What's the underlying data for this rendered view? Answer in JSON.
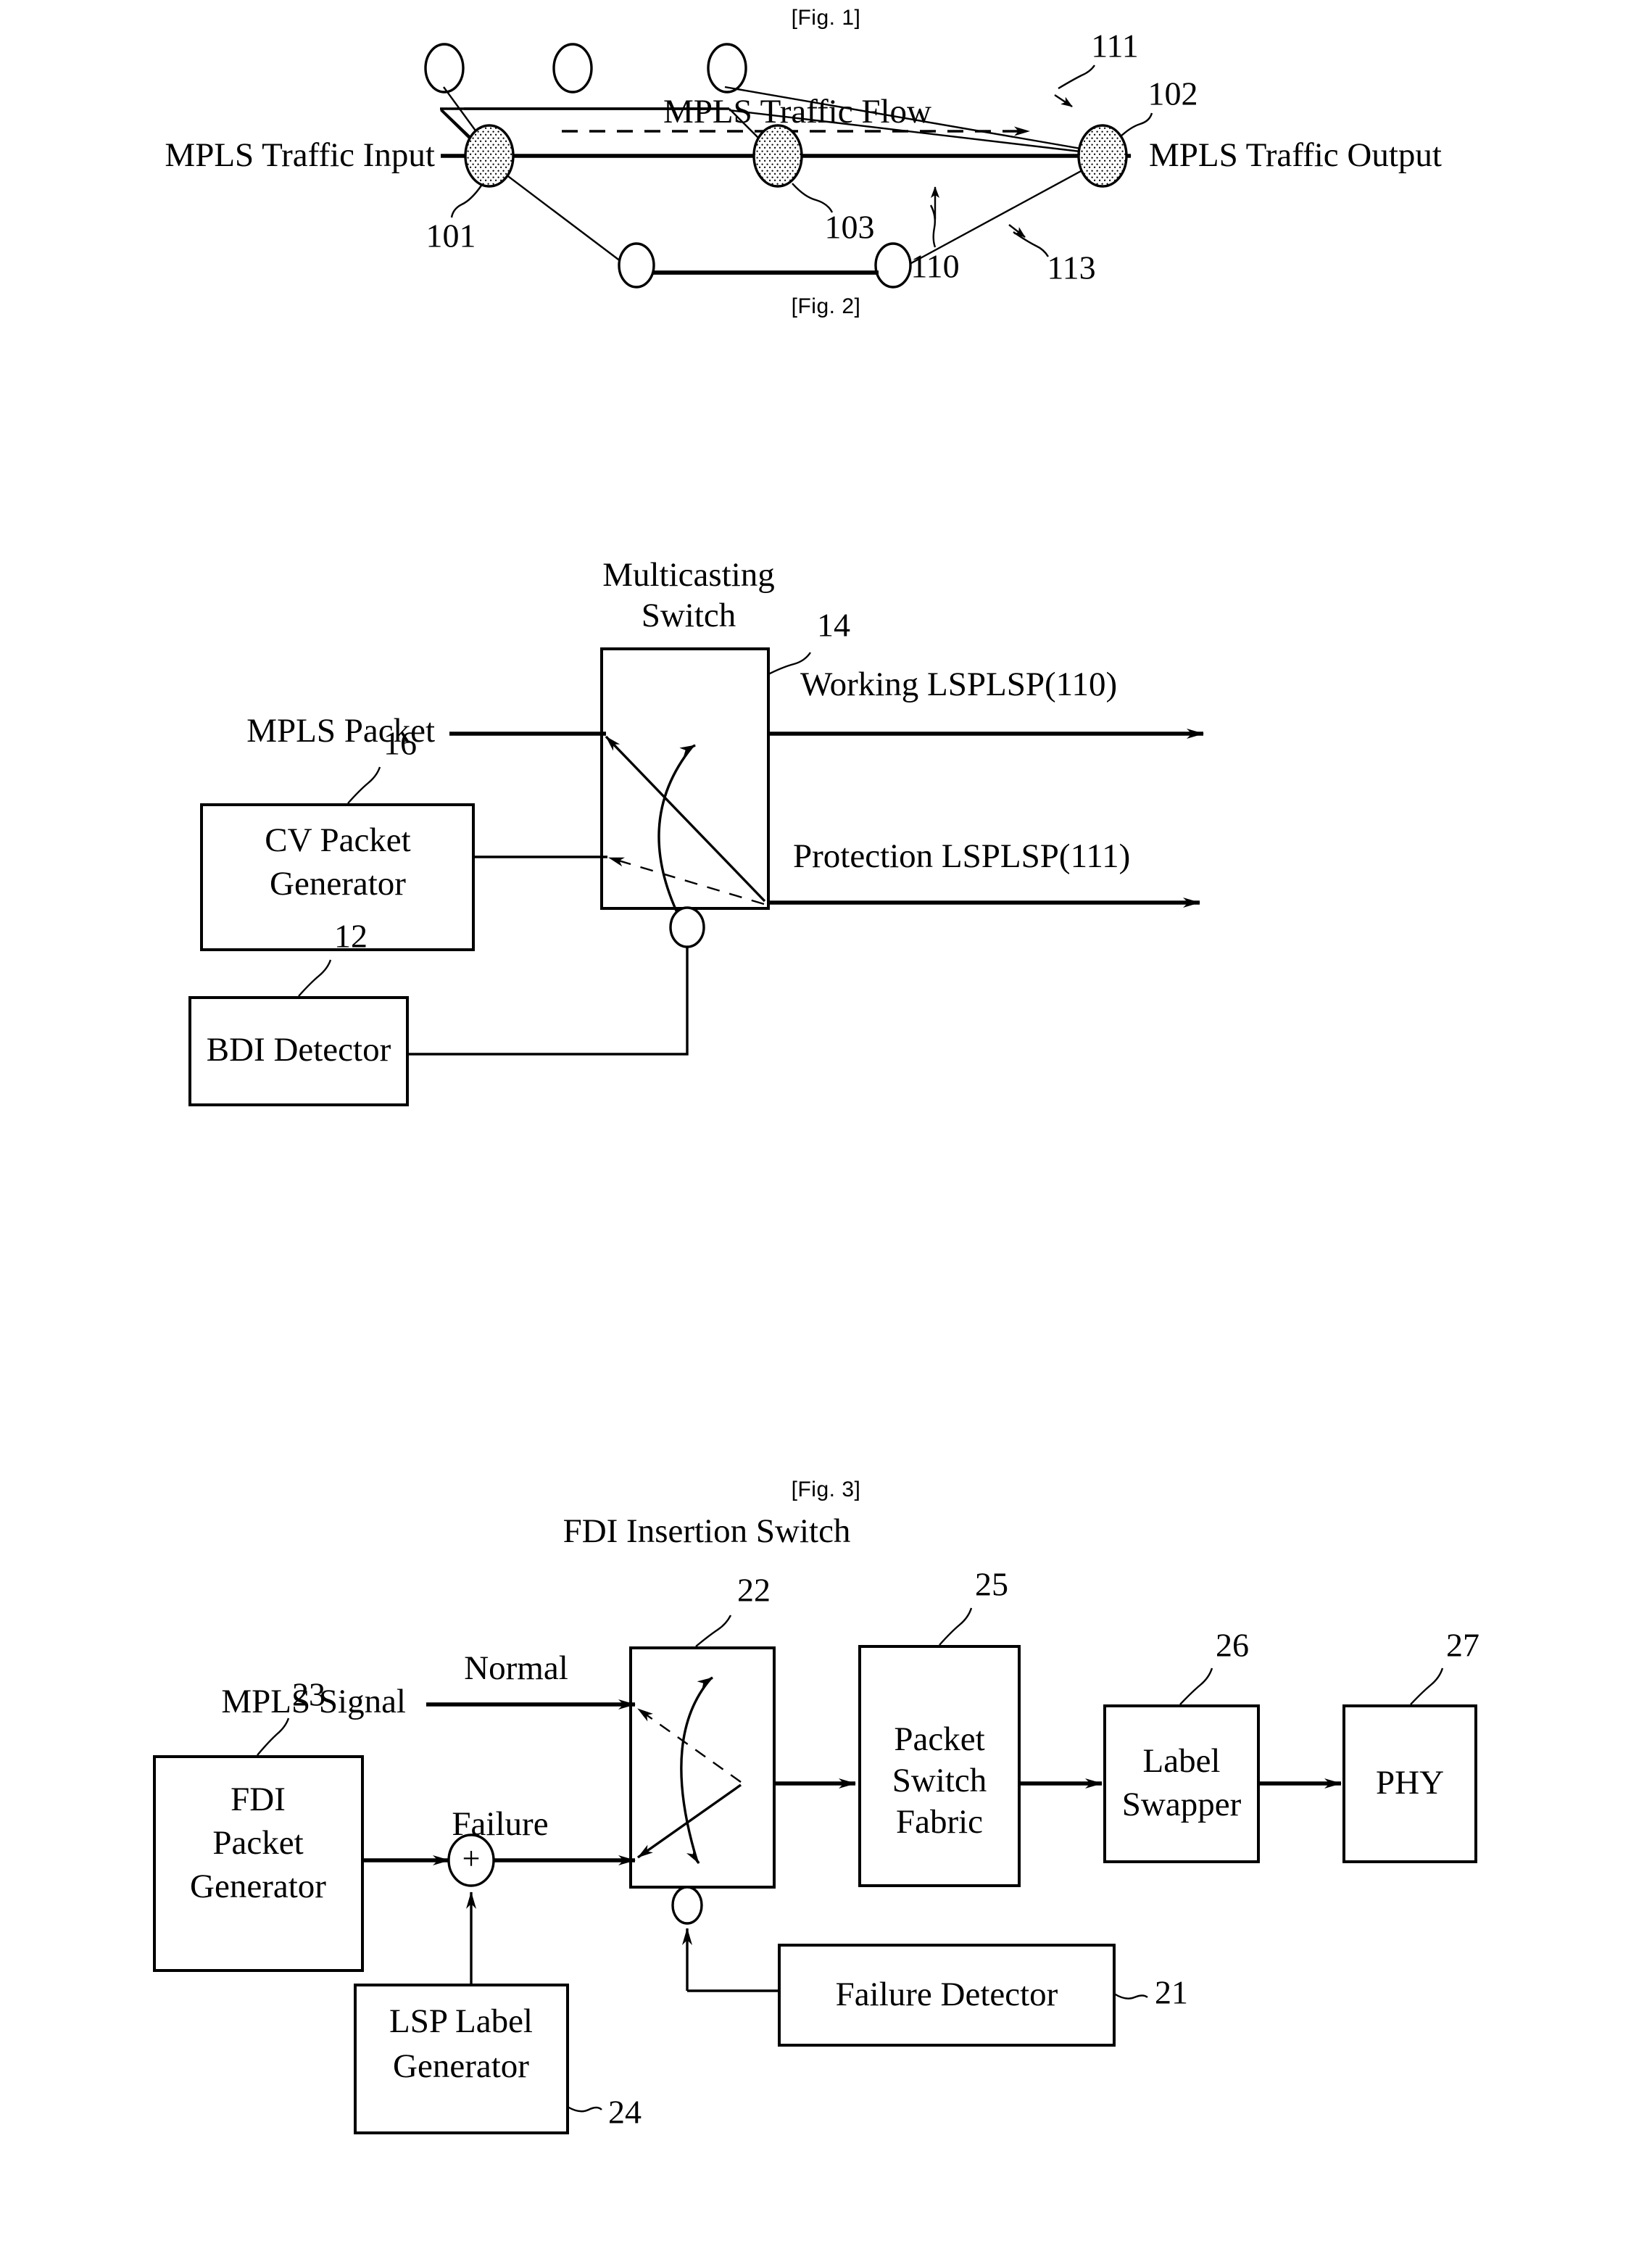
{
  "figures": [
    {
      "caption": "[Fig. 1]",
      "labels": {
        "traffic_input": "MPLS Traffic Input",
        "traffic_output": "MPLS Traffic Output",
        "traffic_flow": "MPLS Traffic Flow"
      },
      "refs": {
        "ingress_node": "101",
        "egress_node": "102",
        "intermediate_node": "103",
        "working_lsp": "110",
        "protection_lsp": "111",
        "alternate_path": "113"
      }
    },
    {
      "caption": "[Fig. 2]",
      "title": {
        "line1": "Multicasting",
        "line2": "Switch"
      },
      "labels": {
        "input_signal": "MPLS Packet",
        "working_output": "Working LSPLSP(110)",
        "protection_output": "Protection LSPLSP(111)"
      },
      "blocks": [
        {
          "ref": "16",
          "line1": "CV Packet",
          "line2": "Generator"
        },
        {
          "ref": "12",
          "line1": "BDI Detector",
          "line2": ""
        }
      ],
      "refs": {
        "switch": "14"
      }
    },
    {
      "caption": "[Fig. 3]",
      "title": "FDI Insertion Switch",
      "labels": {
        "input_signal": "MPLS Signal",
        "normal_path": "Normal",
        "failure_path": "Failure",
        "sum_symbol": "+"
      },
      "blocks": [
        {
          "ref": "23",
          "line1": "FDI",
          "line2": "Packet",
          "line3": "Generator"
        },
        {
          "ref": "24",
          "line1": "LSP Label",
          "line2": "Generator",
          "line3": ""
        },
        {
          "ref": "25",
          "line1": "Packet",
          "line2": "Switch",
          "line3": "Fabric"
        },
        {
          "ref": "26",
          "line1": "Label",
          "line2": "Swapper",
          "line3": ""
        },
        {
          "ref": "27",
          "line1": "PHY",
          "line2": "",
          "line3": ""
        },
        {
          "ref": "21",
          "line1": "Failure Detector",
          "line2": "",
          "line3": ""
        }
      ],
      "refs": {
        "switch": "22"
      }
    }
  ]
}
